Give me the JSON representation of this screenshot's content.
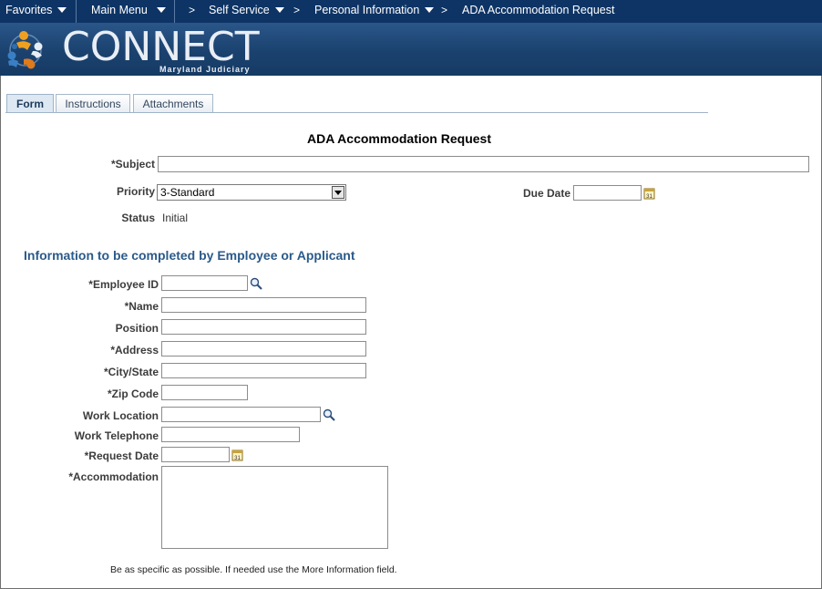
{
  "nav": {
    "favorites": "Favorites",
    "main_menu": "Main Menu",
    "self_service": "Self Service",
    "personal_information": "Personal Information",
    "current_page": "ADA Accommodation Request",
    "arrow": ">"
  },
  "brand": {
    "name": "CONNECT",
    "subtitle": "Maryland Judiciary"
  },
  "tabs": [
    "Form",
    "Instructions",
    "Attachments"
  ],
  "form": {
    "title": "ADA Accommodation Request",
    "subject_label": "*Subject",
    "subject_value": "",
    "priority_label": "Priority",
    "priority_value": "3-Standard",
    "due_date_label": "Due Date",
    "due_date_value": "",
    "status_label": "Status",
    "status_value": "Initial"
  },
  "employee_section": {
    "heading": "Information to be completed by Employee or Applicant",
    "fields": {
      "employee_id": "*Employee ID",
      "name": "*Name",
      "position": "Position",
      "address": "*Address",
      "city_state": "*City/State",
      "zip_code": "*Zip Code",
      "work_location": "Work Location",
      "work_telephone": "Work Telephone",
      "request_date": "*Request Date",
      "accommodation": "*Accommodation"
    },
    "note": "Be as specific as possible. If needed use the More Information field."
  },
  "calendar_icon_text": "31",
  "colors": {
    "navbar": "#0e3465",
    "banner": "#1b426f",
    "section_heading": "#2b5a8a"
  }
}
